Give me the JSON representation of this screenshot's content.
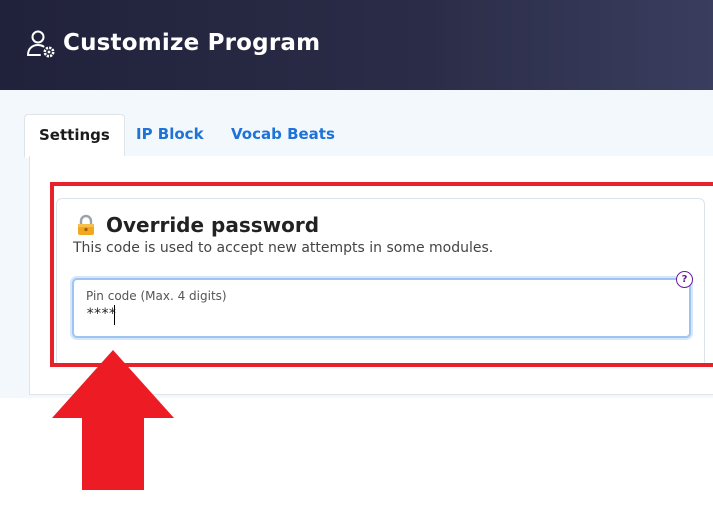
{
  "header": {
    "title": "Customize Program",
    "icon": "user-settings-icon"
  },
  "tabs": [
    {
      "label": "Settings",
      "active": true
    },
    {
      "label": "IP Block",
      "active": false
    },
    {
      "label": "Vocab Beats",
      "active": false
    }
  ],
  "card": {
    "icon": "lock-icon",
    "title": "Override password",
    "description": "This code is used to accept new attempts in some modules.",
    "pin_field": {
      "label": "Pin code (Max. 4 digits)",
      "value": "****",
      "help_icon": "question-mark-icon",
      "help_label": "?"
    }
  },
  "annotation": {
    "highlight_color": "#e8222a",
    "arrow_icon": "up-arrow-icon"
  },
  "colors": {
    "header_bg": "#2b2d48",
    "tab_accent": "#1d73d6",
    "help_color": "#6a1b9a"
  }
}
